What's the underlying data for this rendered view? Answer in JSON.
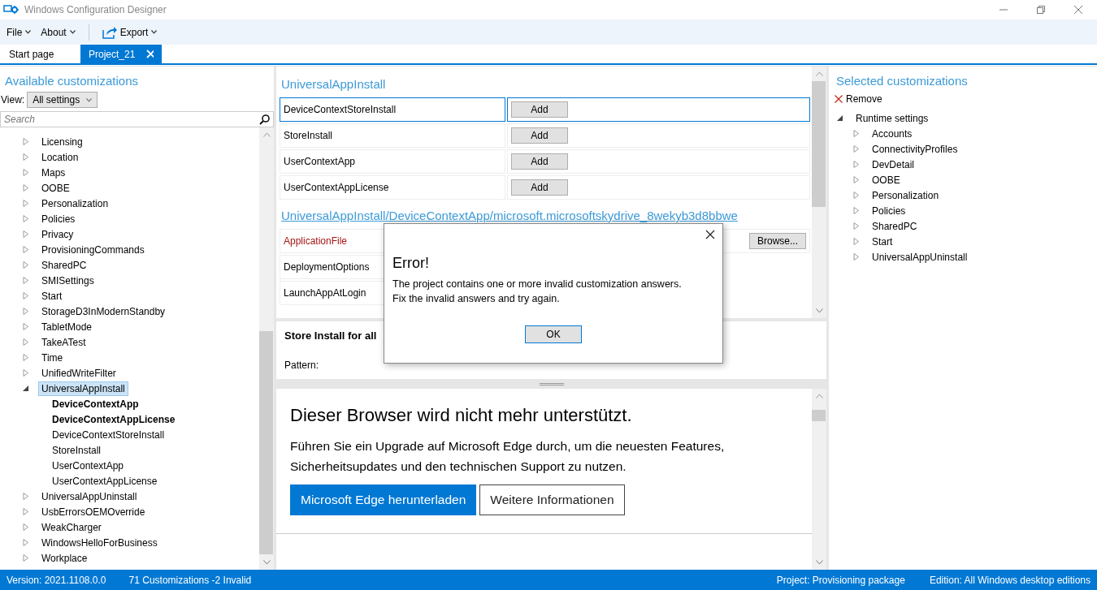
{
  "window": {
    "title": "Windows Configuration Designer"
  },
  "menu": [
    {
      "label": "File"
    },
    {
      "label": "About"
    }
  ],
  "export": {
    "label": "Export"
  },
  "tabs": [
    {
      "label": "Start page",
      "selected": false
    },
    {
      "label": "Project_21",
      "selected": true
    }
  ],
  "available": {
    "title": "Available customizations",
    "view_label": "View:",
    "view_value": "All settings",
    "search": {
      "placeholder": "Search"
    },
    "tree": [
      {
        "label": "Licensing",
        "expanded": false,
        "selected": false
      },
      {
        "label": "Location",
        "expanded": false,
        "selected": false
      },
      {
        "label": "Maps",
        "expanded": false,
        "selected": false
      },
      {
        "label": "OOBE",
        "expanded": false,
        "selected": false
      },
      {
        "label": "Personalization",
        "expanded": false,
        "selected": false
      },
      {
        "label": "Policies",
        "expanded": false,
        "selected": false
      },
      {
        "label": "Privacy",
        "expanded": false,
        "selected": false
      },
      {
        "label": "ProvisioningCommands",
        "expanded": false,
        "selected": false
      },
      {
        "label": "SharedPC",
        "expanded": false,
        "selected": false
      },
      {
        "label": "SMISettings",
        "expanded": false,
        "selected": false
      },
      {
        "label": "Start",
        "expanded": false,
        "selected": false
      },
      {
        "label": "StorageD3InModernStandby",
        "expanded": false,
        "selected": false
      },
      {
        "label": "TabletMode",
        "expanded": false,
        "selected": false
      },
      {
        "label": "TakeATest",
        "expanded": false,
        "selected": false
      },
      {
        "label": "Time",
        "expanded": false,
        "selected": false
      },
      {
        "label": "UnifiedWriteFilter",
        "expanded": false,
        "selected": false
      },
      {
        "label": "UniversalAppInstall",
        "expanded": true,
        "selected": true,
        "children": [
          {
            "label": "DeviceContextApp",
            "configured": true
          },
          {
            "label": "DeviceContextAppLicense",
            "configured": true
          },
          {
            "label": "DeviceContextStoreInstall",
            "configured": false
          },
          {
            "label": "StoreInstall",
            "configured": false
          },
          {
            "label": "UserContextApp",
            "configured": false
          },
          {
            "label": "UserContextAppLicense",
            "configured": false
          }
        ]
      },
      {
        "label": "UniversalAppUninstall",
        "expanded": false,
        "selected": false
      },
      {
        "label": "UsbErrorsOEMOverride",
        "expanded": false,
        "selected": false
      },
      {
        "label": "WeakCharger",
        "expanded": false,
        "selected": false
      },
      {
        "label": "WindowsHelloForBusiness",
        "expanded": false,
        "selected": false
      },
      {
        "label": "Workplace",
        "expanded": false,
        "selected": false
      }
    ]
  },
  "settings": [
    {
      "title": "UniversalAppInstall",
      "link": false,
      "rows": [
        {
          "label": "DeviceContextStoreInstall",
          "selected": true,
          "invalid": false,
          "action": "Add"
        },
        {
          "label": "StoreInstall",
          "selected": false,
          "invalid": false,
          "action": "Add"
        },
        {
          "label": "UserContextApp",
          "selected": false,
          "invalid": false,
          "action": "Add"
        },
        {
          "label": "UserContextAppLicense",
          "selected": false,
          "invalid": false,
          "action": "Add"
        }
      ]
    },
    {
      "title": "UniversalAppInstall/DeviceContextApp/microsoft.microsoftskydrive_8wekyb3d8bbwe",
      "link": true,
      "rows": [
        {
          "label": "ApplicationFile",
          "selected": false,
          "invalid": true,
          "action": "Browse..."
        },
        {
          "label": "DeploymentOptions",
          "selected": false,
          "invalid": false
        },
        {
          "label": "LaunchAppAtLogin",
          "selected": false,
          "invalid": false
        }
      ]
    }
  ],
  "description": {
    "title": "Store Install for all",
    "pattern_label": "Pattern:"
  },
  "browser_notice": {
    "heading": "Dieser Browser wird nicht mehr unterstützt.",
    "text": "Führen Sie ein Upgrade auf Microsoft Edge durch, um die neuesten Features, Sicherheitsupdates und den technischen Support zu nutzen.",
    "buttons": [
      {
        "label": "Microsoft Edge herunterladen",
        "primary": true
      },
      {
        "label": "Weitere Informationen",
        "primary": false
      }
    ]
  },
  "selected_panel": {
    "title": "Selected customizations",
    "remove": "Remove",
    "tree": [
      {
        "label": "Runtime settings",
        "expanded": true,
        "children": [
          {
            "label": "Accounts",
            "expanded": false
          },
          {
            "label": "ConnectivityProfiles",
            "expanded": false
          },
          {
            "label": "DevDetail",
            "expanded": false
          },
          {
            "label": "OOBE",
            "expanded": false
          },
          {
            "label": "Personalization",
            "expanded": false
          },
          {
            "label": "Policies",
            "expanded": false
          },
          {
            "label": "SharedPC",
            "expanded": false
          },
          {
            "label": "Start",
            "expanded": false
          },
          {
            "label": "UniversalAppUninstall",
            "expanded": false
          }
        ]
      }
    ]
  },
  "dialog": {
    "title": "Error!",
    "message": [
      "The project contains one or more invalid customization answers.",
      "Fix the invalid answers and try again."
    ],
    "ok": "OK"
  },
  "status_bar": {
    "version": "Version: 2021.1108.0.0",
    "counts": "71 Customizations -2 Invalid",
    "project": "Project: Provisioning package",
    "edition": "Edition: All Windows desktop editions"
  }
}
